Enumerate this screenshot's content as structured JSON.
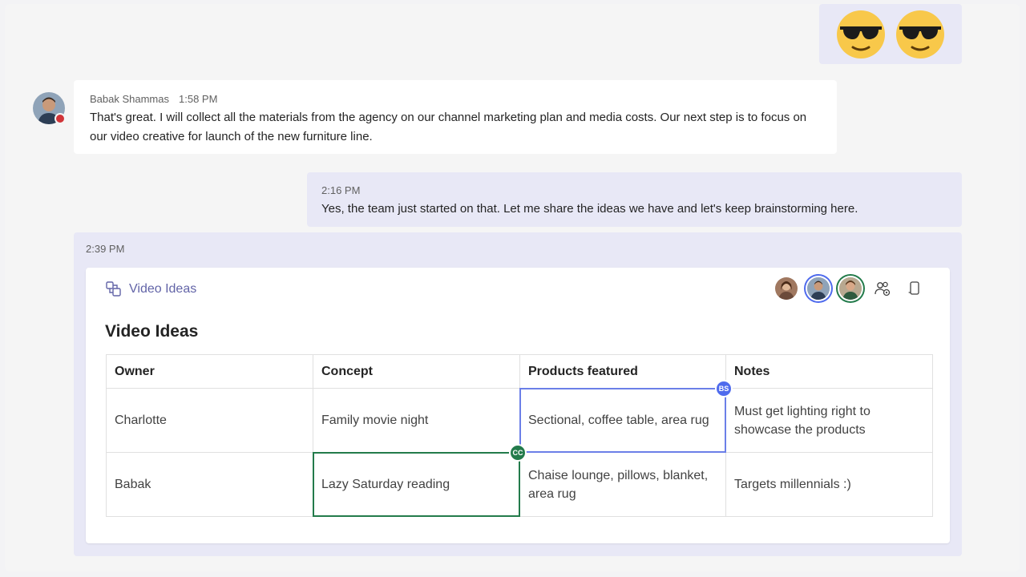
{
  "messages": {
    "incoming": {
      "sender": "Babak Shammas",
      "time": "1:58 PM",
      "text": "That's great. I will collect all the materials from the agency on our channel marketing plan and media costs. Our next step is to focus on our video creative for launch of the new furniture line."
    },
    "outgoing": {
      "time": "2:16 PM",
      "text": "Yes, the team just started on that. Let me share the ideas we have and let's keep brainstorming here."
    },
    "card_message": {
      "time": "2:39 PM"
    }
  },
  "emoji_reaction": {
    "icons": [
      "sunglasses-emoji-icon",
      "sunglasses-emoji-icon"
    ]
  },
  "loop_card": {
    "header_label": "Video Ideas",
    "title": "Video Ideas",
    "table": {
      "columns": [
        "Owner",
        "Concept",
        "Products featured",
        "Notes"
      ],
      "rows": [
        [
          "Charlotte",
          "Family movie night",
          "Sectional, coffee table, area rug",
          "Must get lighting right to showcase the products"
        ],
        [
          "Babak",
          "Lazy Saturday reading",
          "Chaise lounge, pillows, blanket, area rug",
          "Targets millennials :)"
        ]
      ]
    },
    "cursors": {
      "bs": "BS",
      "cc": "CC"
    }
  },
  "colors": {
    "accent": "#6264a7",
    "bubble": "#e8e8f6",
    "cursor_blue": "#4f6bed",
    "cursor_green": "#237b4b",
    "presence_busy": "#d13438"
  }
}
